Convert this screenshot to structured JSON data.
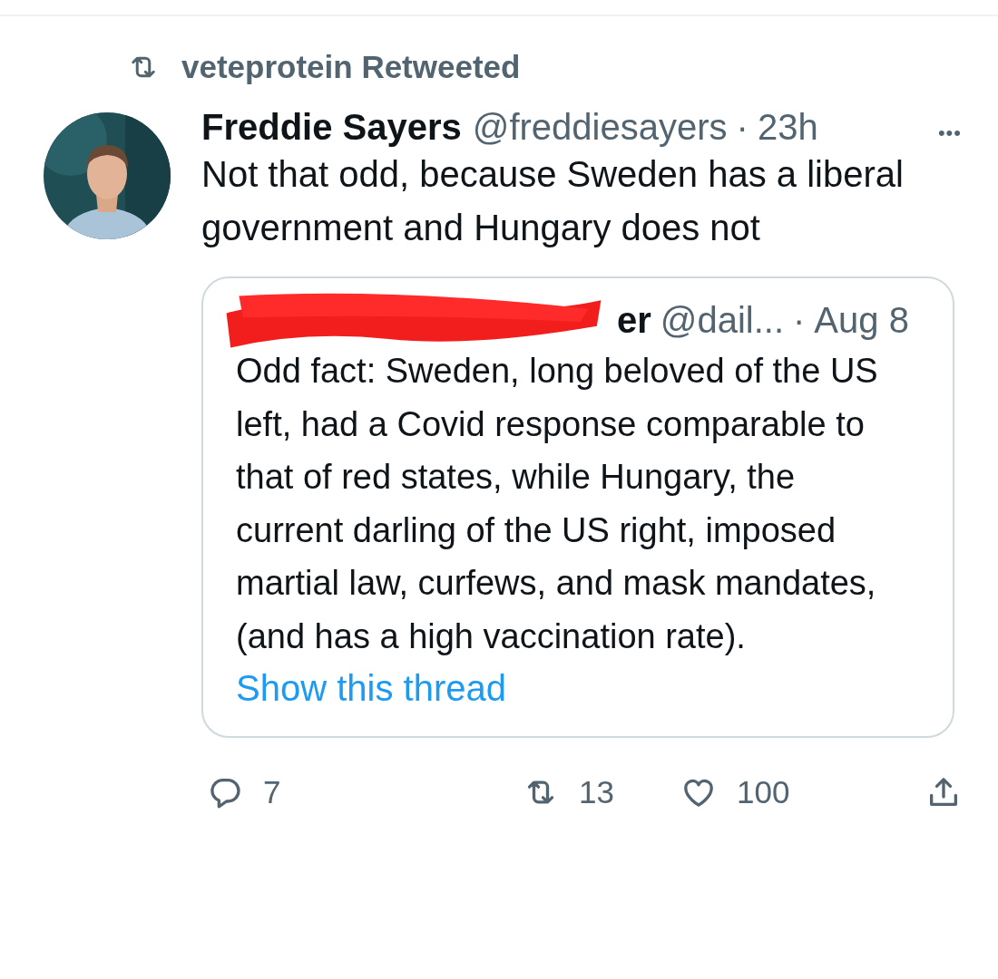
{
  "retweet_banner": {
    "text": "veteprotein Retweeted"
  },
  "tweet": {
    "author": {
      "name": "Freddie Sayers",
      "handle": "@freddiesayers",
      "separator": "·",
      "time": "23h"
    },
    "more": "•••",
    "text": "Not that odd, because Sweden has a liberal government and Hungary does not",
    "quote": {
      "author_visible": "er",
      "redacted": true,
      "handle": "@dail...",
      "separator": "·",
      "time": "Aug 8",
      "text": "Odd fact: Sweden, long beloved of the US left, had a Covid response comparable to that of red states, while Hungary, the current darling of the US right, imposed martial law, curfews, and mask mandates, (and has a high vaccination rate).",
      "link": "Show this thread"
    },
    "actions": [
      {
        "kind": "reply",
        "count": "7"
      },
      {
        "kind": "retweet",
        "count": "13"
      },
      {
        "kind": "like",
        "count": "100"
      },
      {
        "kind": "share"
      }
    ]
  }
}
